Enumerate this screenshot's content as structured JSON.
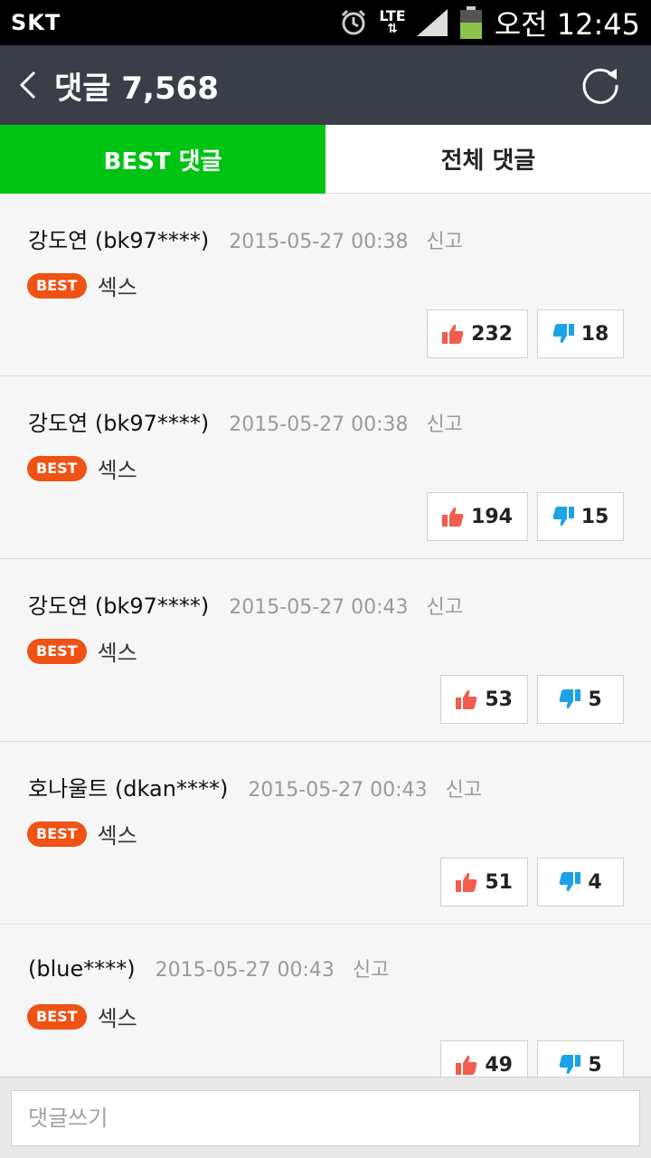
{
  "statusbar": {
    "carrier": "SKT",
    "network": "LTE",
    "time": "오전 12:45",
    "icons": [
      "alarm-icon",
      "lte-icon",
      "signal-icon",
      "battery-icon"
    ]
  },
  "appbar": {
    "title": "댓글 7,568",
    "back_icon": "chevron-left-icon",
    "refresh_icon": "refresh-icon"
  },
  "tabs": [
    {
      "label": "BEST 댓글",
      "active": true
    },
    {
      "label": "전체 댓글",
      "active": false
    }
  ],
  "comments": [
    {
      "author": "강도연 (bk97****)",
      "date": "2015-05-27 00:38",
      "report": "신고",
      "badge": "BEST",
      "text": "섹스",
      "likes": "232",
      "dislikes": "18"
    },
    {
      "author": "강도연 (bk97****)",
      "date": "2015-05-27 00:38",
      "report": "신고",
      "badge": "BEST",
      "text": "섹스",
      "likes": "194",
      "dislikes": "15"
    },
    {
      "author": "강도연 (bk97****)",
      "date": "2015-05-27 00:43",
      "report": "신고",
      "badge": "BEST",
      "text": "섹스",
      "likes": "53",
      "dislikes": "5"
    },
    {
      "author": "호나울트 (dkan****)",
      "date": "2015-05-27 00:43",
      "report": "신고",
      "badge": "BEST",
      "text": "섹스",
      "likes": "51",
      "dislikes": "4"
    },
    {
      "author": "(blue****)",
      "date": "2015-05-27 00:43",
      "report": "신고",
      "badge": "BEST",
      "text": "섹스",
      "likes": "49",
      "dislikes": "5"
    }
  ],
  "input": {
    "placeholder": "댓글쓰기"
  },
  "colors": {
    "accent": "#00c413",
    "appbar": "#3a3e48",
    "badge": "#ee5214",
    "like": "#f25c4f",
    "dislike": "#1da1e8"
  }
}
